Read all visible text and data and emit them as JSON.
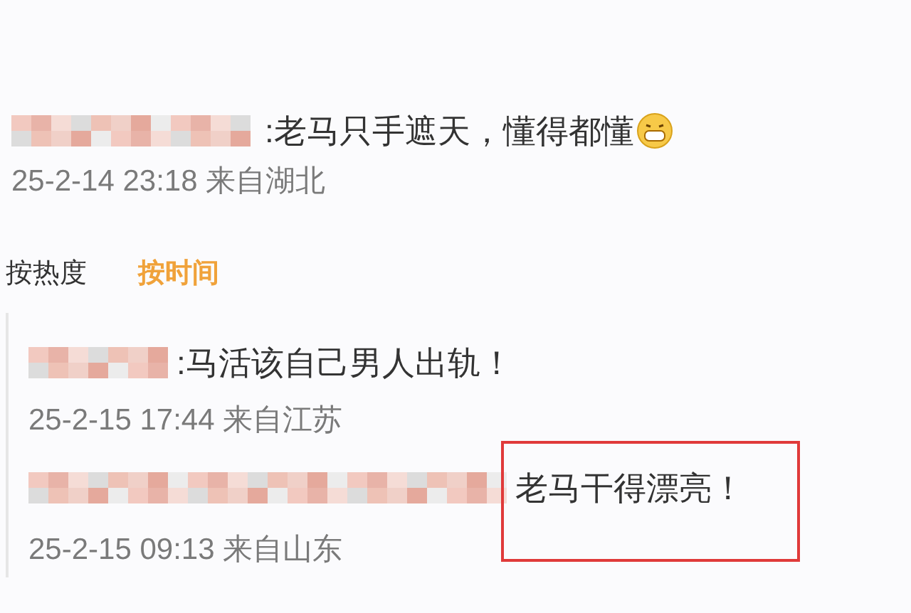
{
  "comment": {
    "text": ":老马只手遮天，懂得都懂",
    "meta": "25-2-14 23:18 来自湖北"
  },
  "sort_tabs": [
    {
      "label": "按热度",
      "selected": false
    },
    {
      "label": "按时间",
      "selected": true
    }
  ],
  "replies": [
    {
      "text": ":马活该自己男人出轨！",
      "meta": "25-2-15 17:44 来自江苏",
      "highlighted": false
    },
    {
      "text": "老马干得漂亮！",
      "meta": "25-2-15 09:13 来自山东",
      "highlighted": true
    }
  ]
}
